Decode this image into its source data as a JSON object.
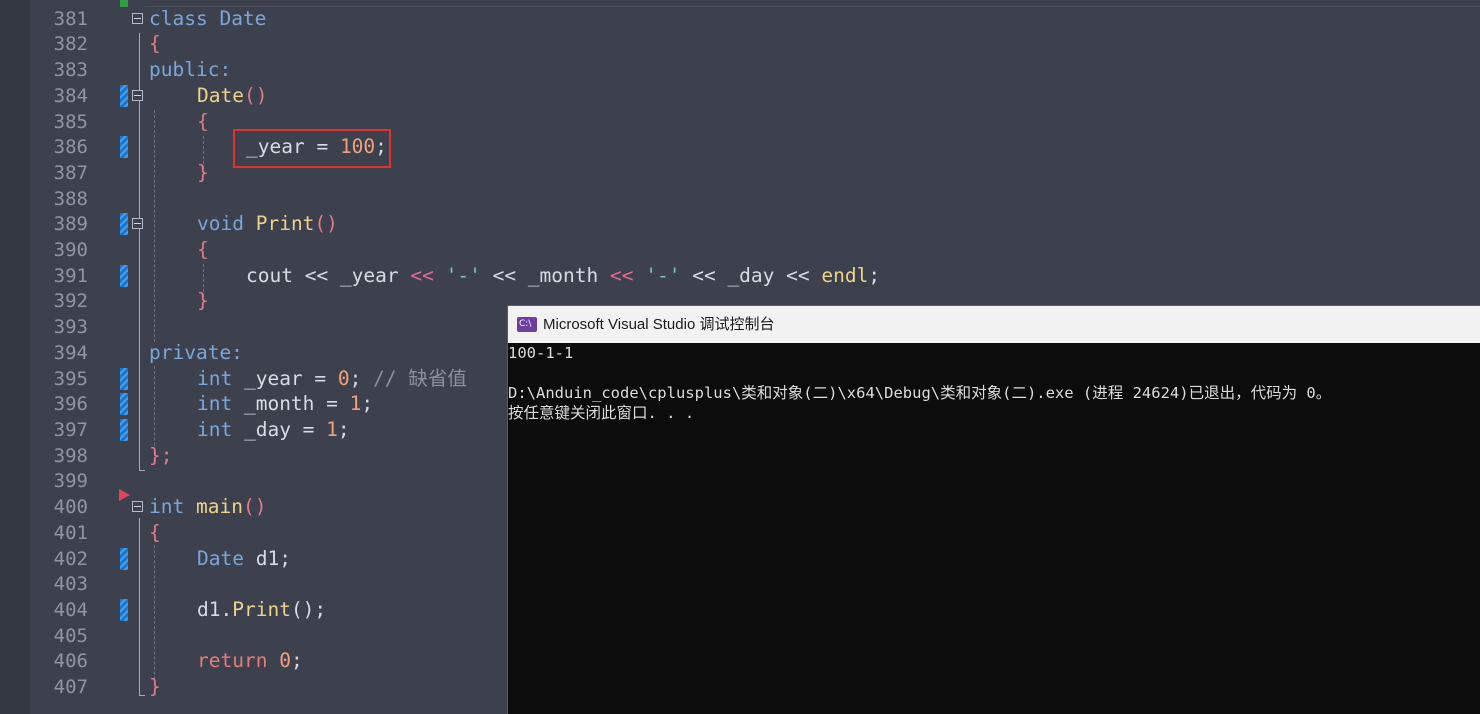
{
  "editor": {
    "lines": [
      {
        "n": "381"
      },
      {
        "n": "382"
      },
      {
        "n": "383"
      },
      {
        "n": "384"
      },
      {
        "n": "385"
      },
      {
        "n": "386"
      },
      {
        "n": "387"
      },
      {
        "n": "388"
      },
      {
        "n": "389"
      },
      {
        "n": "390"
      },
      {
        "n": "391"
      },
      {
        "n": "392"
      },
      {
        "n": "393"
      },
      {
        "n": "394"
      },
      {
        "n": "395"
      },
      {
        "n": "396"
      },
      {
        "n": "397"
      },
      {
        "n": "398"
      },
      {
        "n": "399"
      },
      {
        "n": "400"
      },
      {
        "n": "401"
      },
      {
        "n": "402"
      },
      {
        "n": "403"
      },
      {
        "n": "404"
      },
      {
        "n": "405"
      },
      {
        "n": "406"
      },
      {
        "n": "407"
      }
    ],
    "code": {
      "l381": [
        "class",
        " ",
        "Date"
      ],
      "l382": [
        "{"
      ],
      "l383": [
        "public:"
      ],
      "l384": [
        "Date",
        "()"
      ],
      "l385": [
        "{"
      ],
      "l386": [
        "_year",
        " = ",
        "100",
        ";"
      ],
      "l387": [
        "}"
      ],
      "l389": [
        "void",
        " ",
        "Print",
        "()"
      ],
      "l390": [
        "{"
      ],
      "l391": [
        "cout",
        " << ",
        "_year",
        " << ",
        "'-'",
        " << ",
        "_month",
        " << ",
        "'-'",
        " << ",
        "_day",
        " << ",
        "endl",
        ";"
      ],
      "l392": [
        "}"
      ],
      "l394": [
        "private:"
      ],
      "l395": [
        "int",
        " _year = ",
        "0",
        "; ",
        "// 缺省值"
      ],
      "l396": [
        "int",
        " _month = ",
        "1",
        ";"
      ],
      "l397": [
        "int",
        " _day = ",
        "1",
        ";"
      ],
      "l398": [
        "};"
      ],
      "l400": [
        "int",
        " ",
        "main",
        "()"
      ],
      "l401": [
        "{"
      ],
      "l402": [
        "Date",
        " d1;"
      ],
      "l404": [
        "d1.",
        "Print",
        "();"
      ],
      "l406": [
        "return",
        " ",
        "0",
        ";"
      ],
      "l407": [
        "}"
      ]
    }
  },
  "console": {
    "title": "Microsoft Visual Studio 调试控制台",
    "icon_label": "C:\\",
    "output": [
      "100-1-1",
      "",
      "D:\\Anduin_code\\cplusplus\\类和对象(二)\\x64\\Debug\\类和对象(二).exe (进程 24624)已退出，代码为 0。",
      "按任意键关闭此窗口. . ."
    ]
  },
  "colors": {
    "editor_bg": "#3d414e",
    "keyword": "#7aa6da",
    "function": "#ecd28a",
    "number": "#f2a07c",
    "brace": "#e07a8e",
    "highlight_box": "#e03030",
    "console_bg": "#0c0c0c"
  }
}
